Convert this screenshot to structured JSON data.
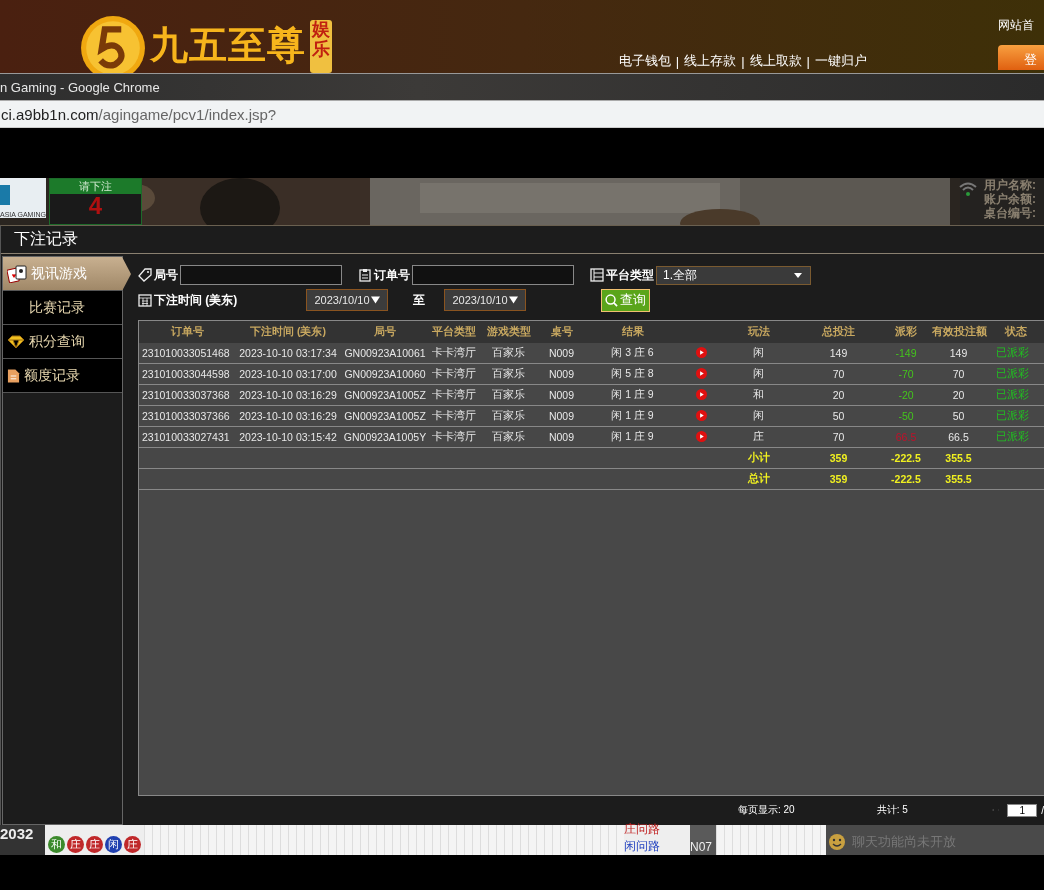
{
  "site_header": {
    "brand": "九五至尊",
    "brand_badge": "娱乐",
    "nav_links": [
      "电子钱包",
      "线上存款",
      "线上取款",
      "一键归户"
    ],
    "nav_separator": "|",
    "top_link": "网站首",
    "logout_button": "登"
  },
  "browser": {
    "title": "n Gaming - Google Chrome",
    "url_host": "ci.a9bb1n.com",
    "url_path": "/agingame/pcv1/index.jsp?"
  },
  "game_strip": {
    "provider": "ASIA GAMING",
    "bet_prompt": "请下注",
    "countdown": "4",
    "info_labels": [
      "用户名称:",
      "账户余额:",
      "桌台编号:"
    ]
  },
  "dialog": {
    "title": "下注记录",
    "menu": [
      {
        "label": "视讯游戏",
        "kind": "cards",
        "selected": true
      },
      {
        "label": "比赛记录",
        "kind": "plain",
        "selected": false
      },
      {
        "label": "积分查询",
        "kind": "diamond",
        "selected": false
      },
      {
        "label": "额度记录",
        "kind": "document",
        "selected": false
      }
    ],
    "filters": {
      "round_label": "局号",
      "order_label": "订单号",
      "platform_label": "平台类型",
      "platform_value": "1.全部",
      "time_label": "下注时间 (美东)",
      "date_from": "2023/10/10",
      "to_label": "至",
      "date_to": "2023/10/10",
      "query_button": "查询"
    },
    "table": {
      "columns": [
        {
          "label": "订单号"
        },
        {
          "label": "下注时间 (美东)"
        },
        {
          "label": "局号"
        },
        {
          "label": "平台类型"
        },
        {
          "label": "游戏类型"
        },
        {
          "label": "桌号"
        },
        {
          "label": "结果"
        },
        {
          "kind": "replay"
        },
        {
          "label": "玩法"
        },
        {
          "label": "总投注"
        },
        {
          "label": "派彩"
        },
        {
          "label": "有效投注额"
        },
        {
          "label": "状态"
        }
      ],
      "rows": [
        {
          "order": "231010033051468",
          "time": "2023-10-10 03:17:34",
          "round": "GN00923A10061",
          "platform": "卡卡湾厅",
          "game": "百家乐",
          "table": "N009",
          "result": "闲 3 庄 6",
          "play": "闲",
          "bet": "149",
          "payout": "-149",
          "color": "#44c41c",
          "valid": "149",
          "status": "已派彩"
        },
        {
          "order": "231010033044598",
          "time": "2023-10-10 03:17:00",
          "round": "GN00923A10060",
          "platform": "卡卡湾厅",
          "game": "百家乐",
          "table": "N009",
          "result": "闲 5 庄 8",
          "play": "闲",
          "bet": "70",
          "payout": "-70",
          "color": "#44c41c",
          "valid": "70",
          "status": "已派彩"
        },
        {
          "order": "231010033037368",
          "time": "2023-10-10 03:16:29",
          "round": "GN00923A1005Z",
          "platform": "卡卡湾厅",
          "game": "百家乐",
          "table": "N009",
          "result": "闲 1 庄 9",
          "play": "和",
          "bet": "20",
          "payout": "-20",
          "color": "#44c41c",
          "valid": "20",
          "status": "已派彩"
        },
        {
          "order": "231010033037366",
          "time": "2023-10-10 03:16:29",
          "round": "GN00923A1005Z",
          "platform": "卡卡湾厅",
          "game": "百家乐",
          "table": "N009",
          "result": "闲 1 庄 9",
          "play": "闲",
          "bet": "50",
          "payout": "-50",
          "color": "#44c41c",
          "valid": "50",
          "status": "已派彩"
        },
        {
          "order": "231010033027431",
          "time": "2023-10-10 03:15:42",
          "round": "GN00923A1005Y",
          "platform": "卡卡湾厅",
          "game": "百家乐",
          "table": "N009",
          "result": "闲 1 庄 9",
          "play": "庄",
          "bet": "70",
          "payout": "66.5",
          "color": "#c0102a",
          "valid": "66.5",
          "status": "已派彩"
        }
      ],
      "summary": [
        {
          "label": "小计",
          "bet": "359",
          "payout": "-222.5",
          "valid": "355.5"
        },
        {
          "label": "总计",
          "bet": "359",
          "payout": "-222.5",
          "valid": "355.5"
        }
      ]
    },
    "footer": {
      "page_size": "每页显示: 20",
      "total": "共计: 5",
      "page": "1",
      "page_separator": "/"
    }
  },
  "bottom_strip": {
    "shoe_number": "2032",
    "beads": [
      {
        "label": "和",
        "color": "#3c8a2c"
      },
      {
        "label": "庄",
        "color": "#c0282a"
      },
      {
        "label": "庄",
        "color": "#c0282a"
      },
      {
        "label": "闲",
        "color": "#2040b0"
      },
      {
        "label": "庄",
        "color": "#c0282a"
      }
    ],
    "ask_banker": "庄问路",
    "ask_player": "闲问路",
    "table_code": "N07",
    "chat_notice": "聊天功能尚未开放"
  }
}
